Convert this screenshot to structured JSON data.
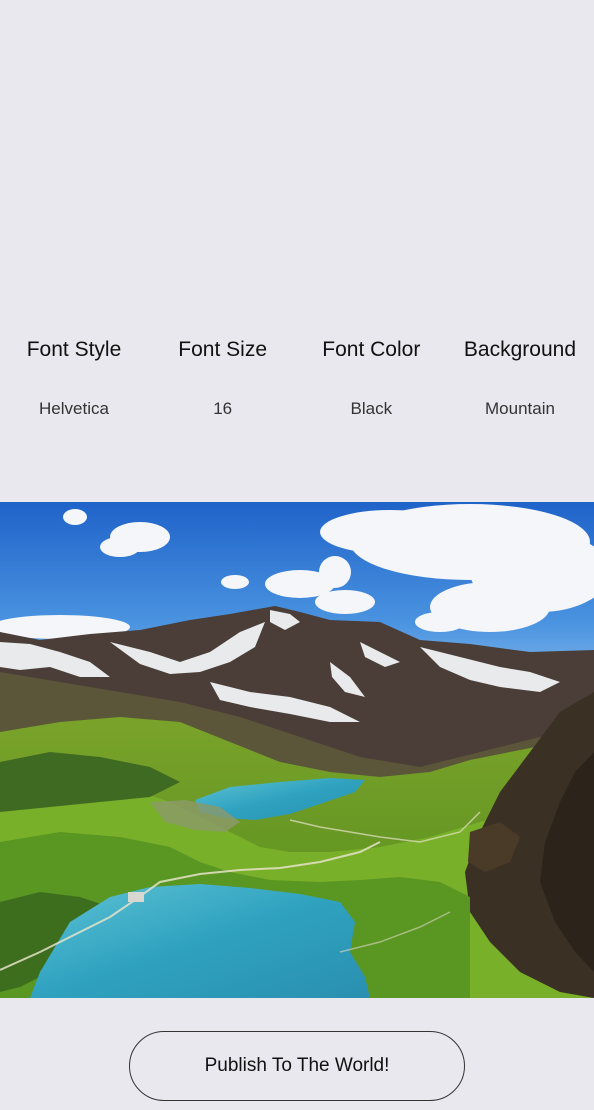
{
  "settings": [
    {
      "label": "Font Style",
      "value": "Helvetica"
    },
    {
      "label": "Font Size",
      "value": "16"
    },
    {
      "label": "Font Color",
      "value": "Black"
    },
    {
      "label": "Background",
      "value": "Mountain"
    }
  ],
  "preview": {
    "icon": "mountain-landscape-image"
  },
  "publish_button": {
    "label": "Publish To The World!"
  },
  "colors": {
    "background": "#e9e8ee",
    "text": "#111111",
    "button_border": "#333333"
  }
}
